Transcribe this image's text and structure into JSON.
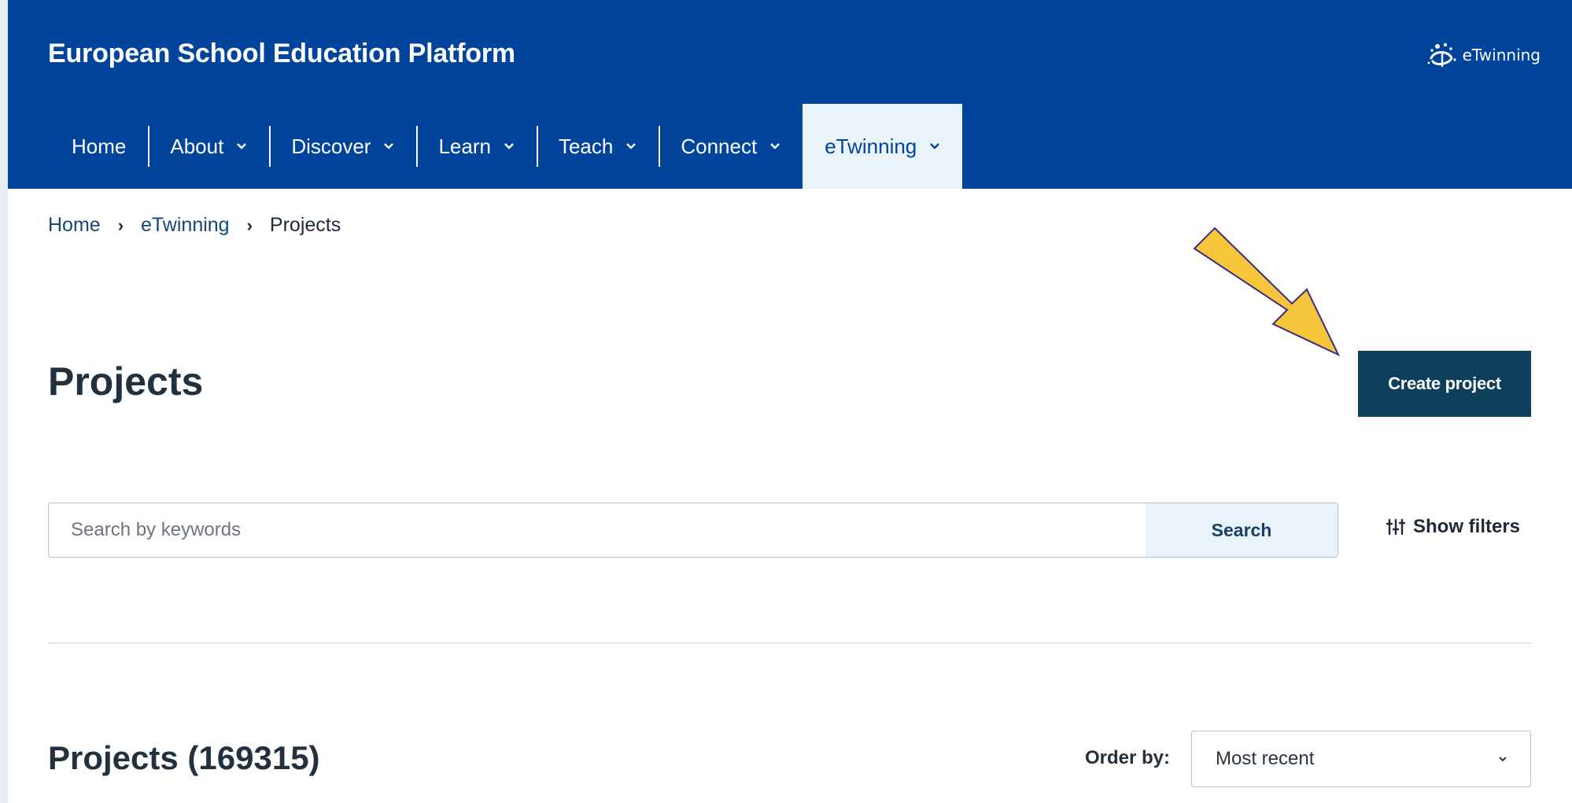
{
  "header": {
    "site_title": "European School Education Platform",
    "logo_text": "eTwinning"
  },
  "nav": {
    "items": [
      {
        "label": "Home",
        "has_dropdown": false
      },
      {
        "label": "About",
        "has_dropdown": true
      },
      {
        "label": "Discover",
        "has_dropdown": true
      },
      {
        "label": "Learn",
        "has_dropdown": true
      },
      {
        "label": "Teach",
        "has_dropdown": true
      },
      {
        "label": "Connect",
        "has_dropdown": true
      },
      {
        "label": "eTwinning",
        "has_dropdown": true,
        "active": true
      }
    ]
  },
  "breadcrumb": {
    "items": [
      "Home",
      "eTwinning"
    ],
    "current": "Projects"
  },
  "main": {
    "title": "Projects",
    "create_label": "Create project"
  },
  "search": {
    "placeholder": "Search by keywords",
    "button_label": "Search",
    "filters_label": "Show filters"
  },
  "results": {
    "title": "Projects (169315)",
    "order_label": "Order by:",
    "order_value": "Most recent"
  },
  "colors": {
    "header_bg": "#00449b",
    "active_tab_bg": "#e8f3fa",
    "create_button_bg": "#0b3f5a",
    "annotation_arrow": "#f5c53a"
  }
}
